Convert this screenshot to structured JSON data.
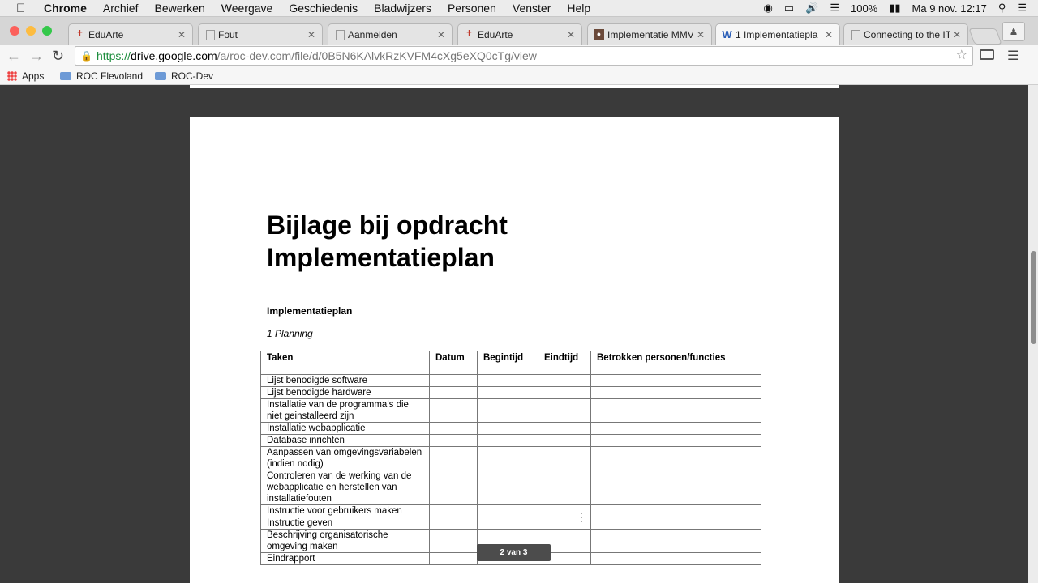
{
  "menubar": {
    "items": [
      "Chrome",
      "Archief",
      "Bewerken",
      "Weergave",
      "Geschiedenis",
      "Bladwijzers",
      "Personen",
      "Venster",
      "Help"
    ],
    "battery": "100%",
    "clock": "Ma 9 nov.  12:17"
  },
  "tabs": [
    {
      "label": "EduArte",
      "favicon": "eduarte-icon"
    },
    {
      "label": "Fout",
      "favicon": "page-icon"
    },
    {
      "label": "Aanmelden",
      "favicon": "page-icon"
    },
    {
      "label": "EduArte",
      "favicon": "eduarte-icon"
    },
    {
      "label": "Implementatie MMV",
      "favicon": "classroom-icon"
    },
    {
      "label": "1 Implementatiepla",
      "favicon": "word-icon"
    },
    {
      "label": "Connecting to the IT",
      "favicon": "page-icon"
    }
  ],
  "omnibox": {
    "scheme": "https://",
    "host": "drive.google.com",
    "path": "/a/roc-dev.com/file/d/0B5N6KAlvkRzKVFM4cXg5eXQ0cTg/view"
  },
  "bookmarks": [
    "Apps",
    "ROC Flevoland",
    "ROC-Dev"
  ],
  "document": {
    "title_line1": "Bijlage bij opdracht",
    "title_line2": "Implementatieplan",
    "subheading": "Implementatieplan",
    "section": "1 Planning",
    "table": {
      "headers": [
        "Taken",
        "Datum",
        "Begintijd",
        "Eindtijd",
        "Betrokken personen/functies"
      ],
      "rows": [
        "Lijst benodigde software",
        "Lijst benodigde hardware",
        "Installatie van de programma’s die niet geinstalleerd zijn",
        "Installatie webapplicatie",
        "Database inrichten",
        "Aanpassen van omgevingsvariabelen (indien nodig)",
        "Controleren van de werking van de webapplicatie en herstellen van installatiefouten",
        "Instructie voor gebruikers maken",
        "Instructie geven",
        "Beschrijving organisatorische omgeving maken",
        "Eindrapport"
      ]
    }
  },
  "page_indicator": "2 van 3"
}
